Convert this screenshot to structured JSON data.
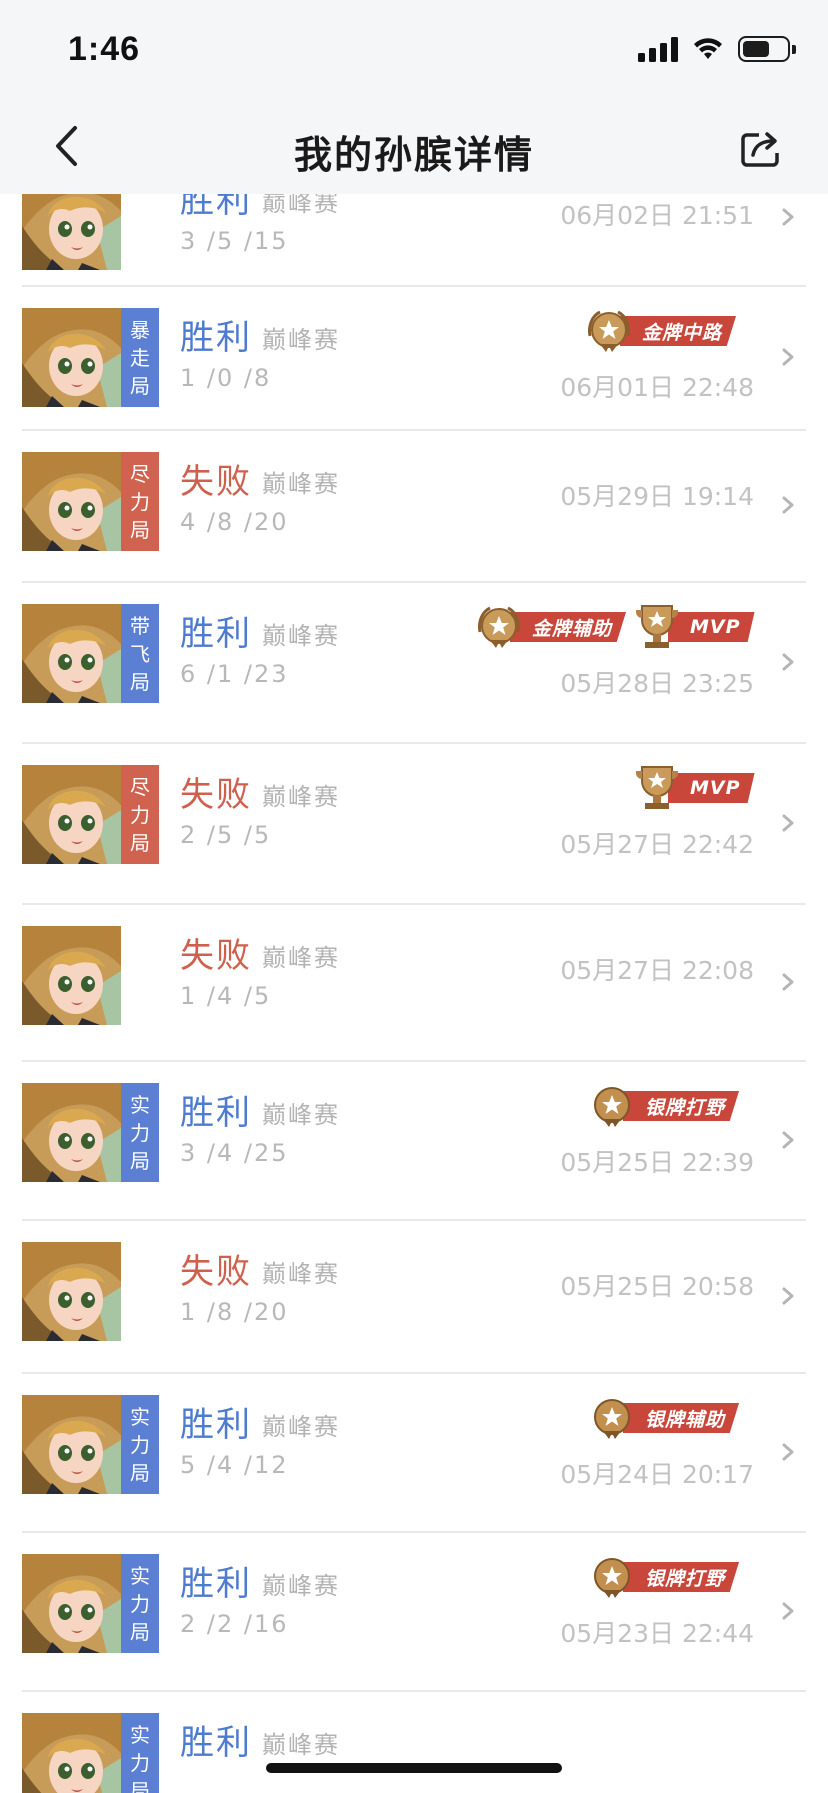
{
  "status_bar": {
    "time": "1:46"
  },
  "nav": {
    "title": "我的孙膑详情",
    "back_icon": "chevron-left-icon",
    "share_icon": "share-icon"
  },
  "colors": {
    "win": "#4d7bd0",
    "lose": "#d0604e",
    "tag_blue": "#5a7fd3",
    "tag_red": "#d0634f",
    "badge_red": "#c9463a"
  },
  "matches": [
    {
      "result": "胜利",
      "mode": "巅峰赛",
      "kda": "3 /5 /15",
      "date": "06月02日 21:51",
      "tag": "",
      "badges": []
    },
    {
      "result": "胜利",
      "mode": "巅峰赛",
      "kda": "1 /0 /8",
      "date": "06月01日 22:48",
      "tag": "暴走局",
      "badges": [
        "金牌中路"
      ]
    },
    {
      "result": "失败",
      "mode": "巅峰赛",
      "kda": "4 /8 /20",
      "date": "05月29日 19:14",
      "tag": "尽力局",
      "badges": []
    },
    {
      "result": "胜利",
      "mode": "巅峰赛",
      "kda": "6 /1 /23",
      "date": "05月28日 23:25",
      "tag": "带飞局",
      "badges": [
        "金牌辅助",
        "MVP"
      ]
    },
    {
      "result": "失败",
      "mode": "巅峰赛",
      "kda": "2 /5 /5",
      "date": "05月27日 22:42",
      "tag": "尽力局",
      "badges": [
        "MVP"
      ]
    },
    {
      "result": "失败",
      "mode": "巅峰赛",
      "kda": "1 /4 /5",
      "date": "05月27日 22:08",
      "tag": "",
      "badges": []
    },
    {
      "result": "胜利",
      "mode": "巅峰赛",
      "kda": "3 /4 /25",
      "date": "05月25日 22:39",
      "tag": "实力局",
      "badges": [
        "银牌打野"
      ]
    },
    {
      "result": "失败",
      "mode": "巅峰赛",
      "kda": "1 /8 /20",
      "date": "05月25日 20:58",
      "tag": "",
      "badges": []
    },
    {
      "result": "胜利",
      "mode": "巅峰赛",
      "kda": "5 /4 /12",
      "date": "05月24日 20:17",
      "tag": "实力局",
      "badges": [
        "银牌辅助"
      ]
    },
    {
      "result": "胜利",
      "mode": "巅峰赛",
      "kda": "2 /2 /16",
      "date": "05月23日 22:44",
      "tag": "实力局",
      "badges": [
        "银牌打野"
      ]
    },
    {
      "result": "胜利",
      "mode": "巅峰赛",
      "kda": "",
      "date": "",
      "tag": "实力局",
      "badges": []
    }
  ]
}
